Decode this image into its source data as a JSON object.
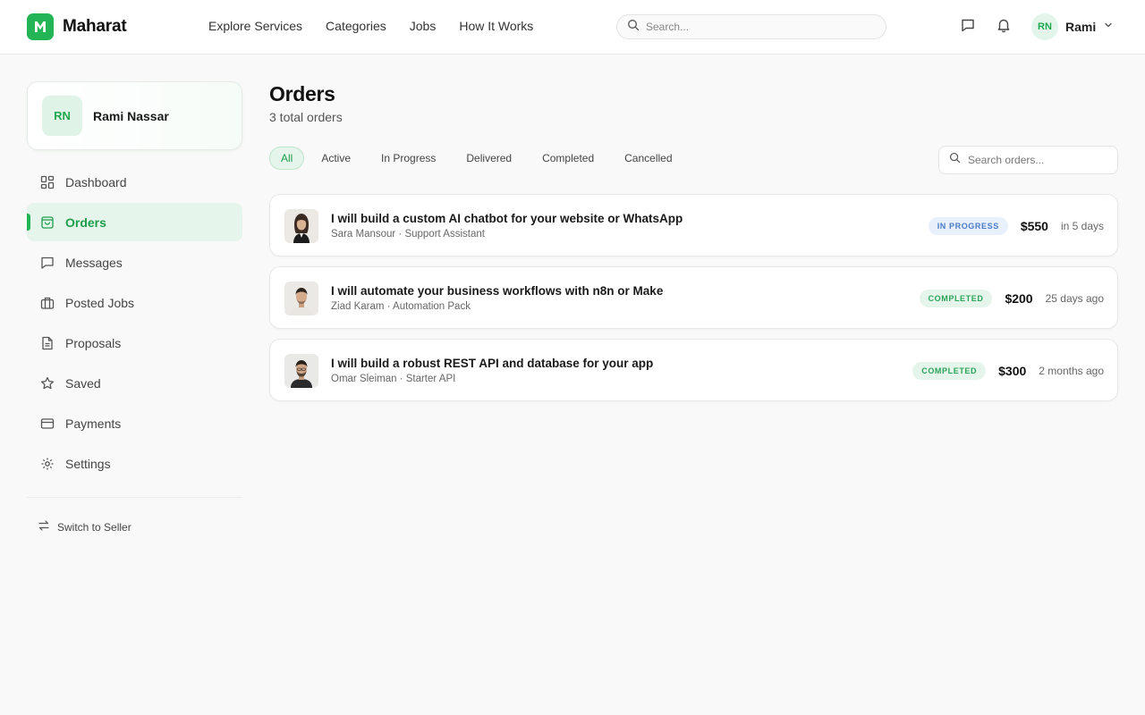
{
  "brand": {
    "name": "Maharat",
    "logo_letter": "M",
    "accent": "#22b455"
  },
  "nav": {
    "links": [
      "Explore Services",
      "Categories",
      "Jobs",
      "How It Works"
    ]
  },
  "search": {
    "placeholder": "Search..."
  },
  "user": {
    "initials": "RN",
    "first_name": "Rami",
    "full_name": "Rami Nassar"
  },
  "sidebar": {
    "items": [
      {
        "label": "Dashboard",
        "icon": "grid-icon",
        "active": false
      },
      {
        "label": "Orders",
        "icon": "shopping-bag-icon",
        "active": true
      },
      {
        "label": "Messages",
        "icon": "message-icon",
        "active": false
      },
      {
        "label": "Posted Jobs",
        "icon": "briefcase-icon",
        "active": false
      },
      {
        "label": "Proposals",
        "icon": "document-icon",
        "active": false
      },
      {
        "label": "Saved",
        "icon": "star-icon",
        "active": false
      },
      {
        "label": "Payments",
        "icon": "credit-card-icon",
        "active": false
      },
      {
        "label": "Settings",
        "icon": "gear-icon",
        "active": false
      }
    ],
    "switch_label": "Switch to Seller"
  },
  "page": {
    "title": "Orders",
    "subtitle": "3 total orders"
  },
  "tabs": [
    "All",
    "Active",
    "In Progress",
    "Delivered",
    "Completed",
    "Cancelled"
  ],
  "order_search": {
    "placeholder": "Search orders..."
  },
  "orders": [
    {
      "title": "I will build a custom AI chatbot for your website or WhatsApp",
      "seller": "Sara Mansour",
      "package": "Support Assistant",
      "meta": "Sara Mansour · Support Assistant",
      "status": "IN PROGRESS",
      "status_type": "progress",
      "price": "$550",
      "due": "in 5 days"
    },
    {
      "title": "I will automate your business workflows with n8n or Make",
      "seller": "Ziad Karam",
      "package": "Automation Pack",
      "meta": "Ziad Karam · Automation Pack",
      "status": "COMPLETED",
      "status_type": "completed",
      "price": "$200",
      "due": "25 days ago"
    },
    {
      "title": "I will build a robust REST API and database for your app",
      "seller": "Omar Sleiman",
      "package": "Starter API",
      "meta": "Omar Sleiman · Starter API",
      "status": "COMPLETED",
      "status_type": "completed",
      "price": "$300",
      "due": "2 months ago"
    }
  ]
}
